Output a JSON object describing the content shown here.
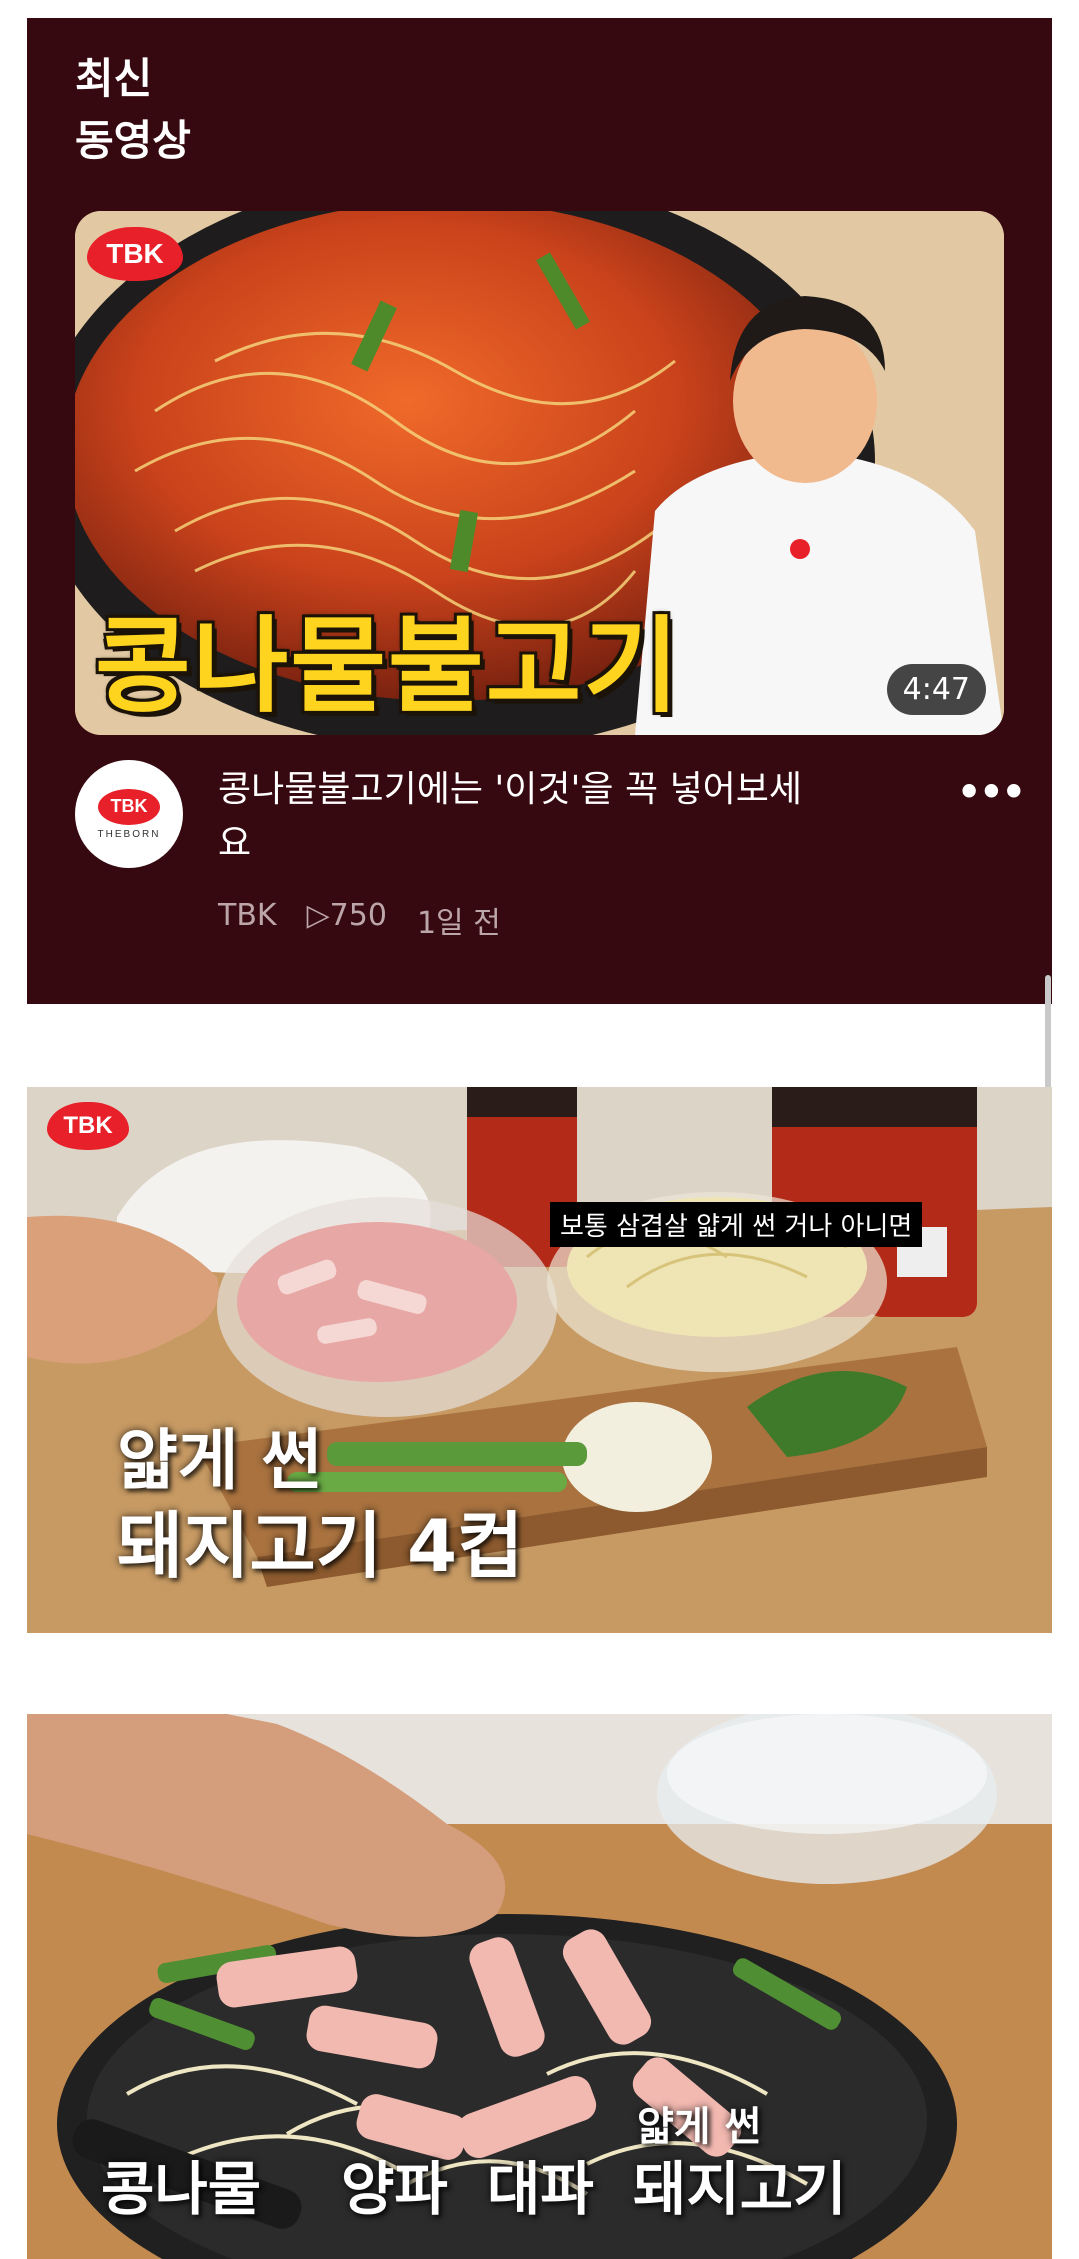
{
  "section": {
    "title_line1": "최신",
    "title_line2": "동영상"
  },
  "featured_video": {
    "thumbnail_logo": "TBK",
    "thumbnail_caption": "콩나물불고기",
    "duration": "4:47",
    "title": "콩나물불고기에는 '이것'을 꼭 넣어보세요",
    "channel": "TBK",
    "views": "▷750",
    "age": "1일 전",
    "more_icon": "more-vert-icon",
    "avatar_logo": "TBK",
    "avatar_sub": "THEBORN"
  },
  "frame1": {
    "logo": "TBK",
    "subtitle": "보통 삼겹살 얇게 썬 거나 아니면",
    "caption_line1": "얇게 썬",
    "caption_line2": "돼지고기 4컵"
  },
  "frame2": {
    "caption_small": "얇게 썬",
    "caption_items": [
      "콩나물",
      "양파",
      "대파",
      "돼지고기"
    ]
  },
  "colors": {
    "card_bg": "#35090f",
    "brand_red": "#e8202a",
    "caption_yellow": "#ffd41e"
  }
}
